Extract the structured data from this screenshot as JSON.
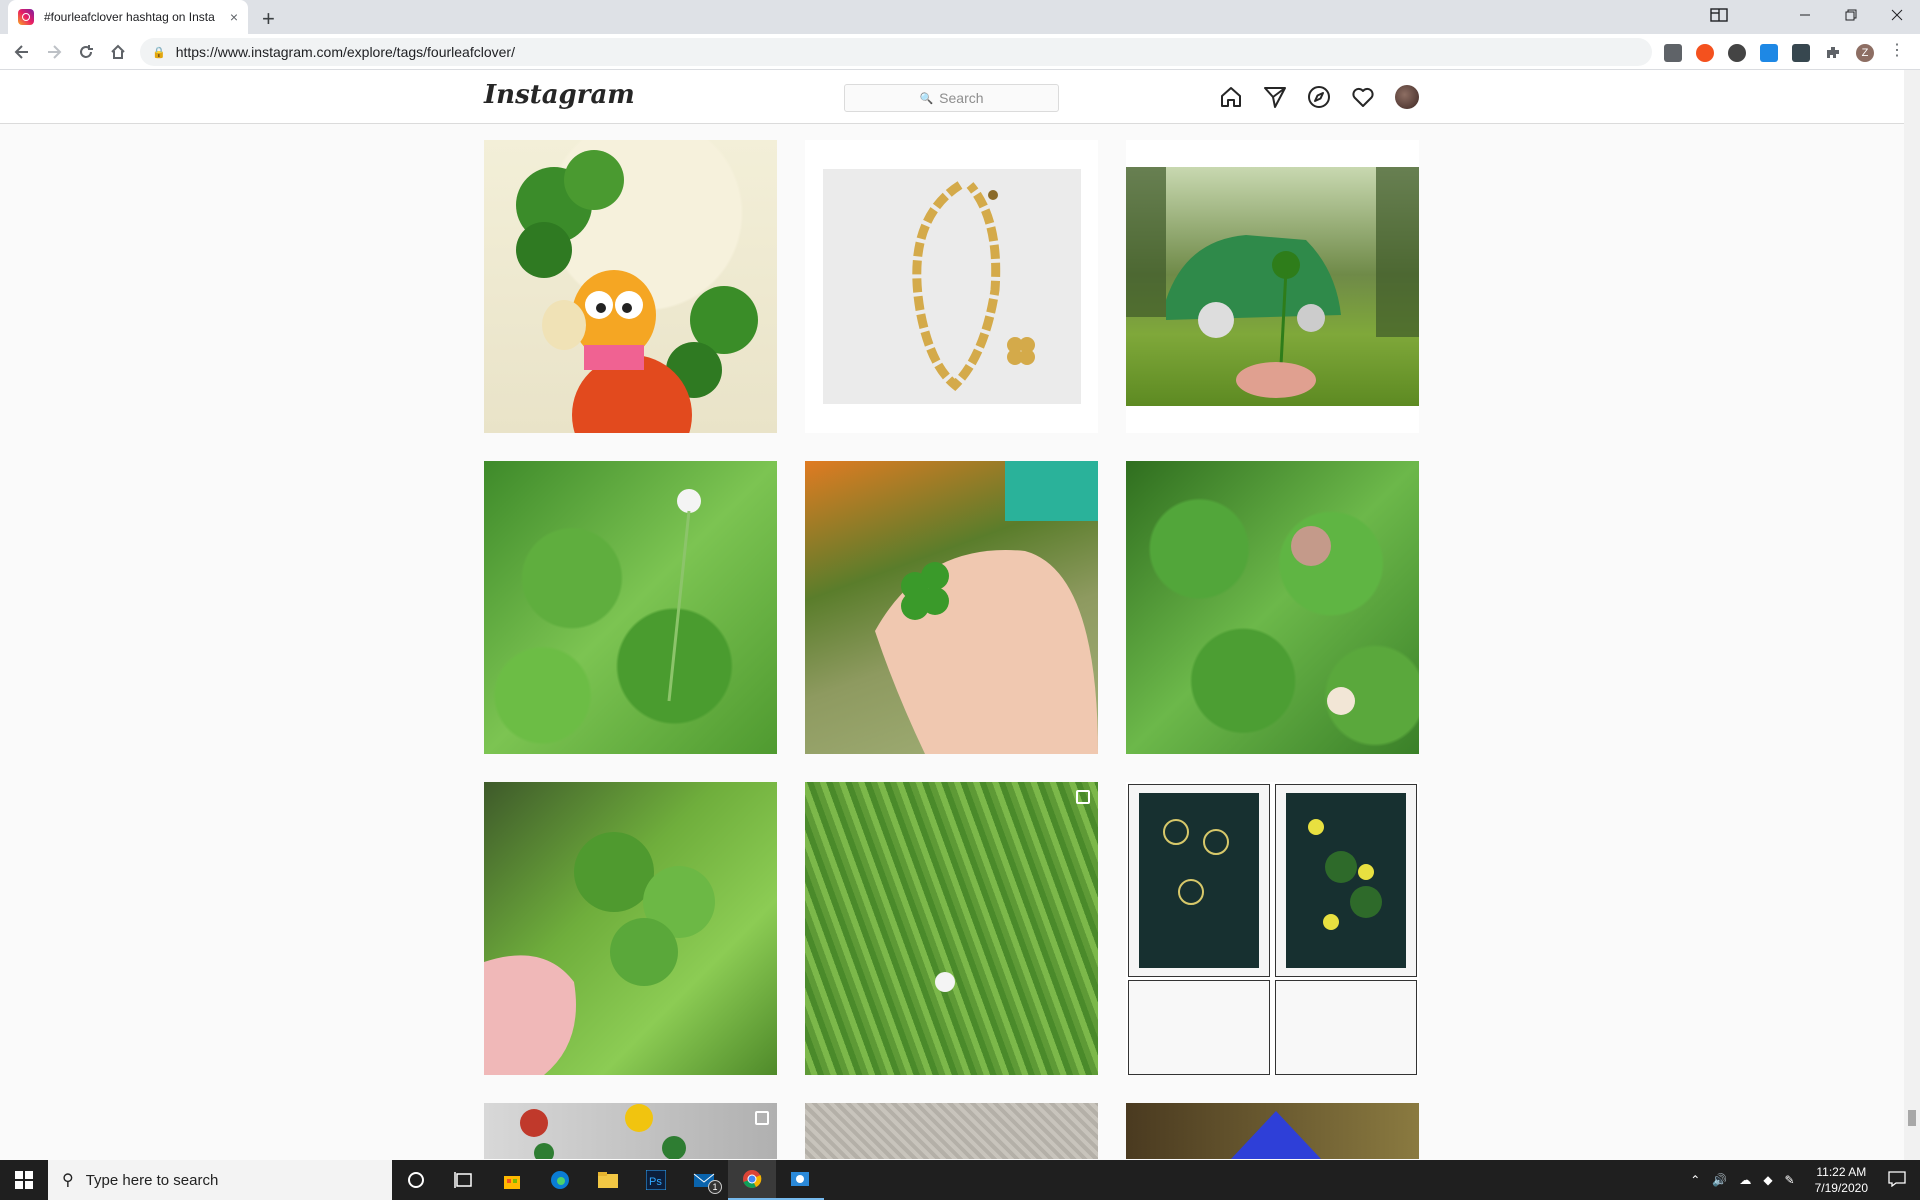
{
  "browser": {
    "tab_title": "#fourleafclover hashtag on Insta",
    "new_tab": "+",
    "close": "×",
    "url": "https://www.instagram.com/explore/tags/fourleafclover/",
    "profile_initial": "Z"
  },
  "instagram": {
    "logo": "Instagram",
    "search_placeholder": "Search",
    "nav_icons": [
      "home-icon",
      "direct-icon",
      "explore-icon",
      "activity-icon",
      "profile-avatar"
    ]
  },
  "grid": {
    "posts": [
      {
        "name": "garfield-clover",
        "multi": false
      },
      {
        "name": "gold-clover-bracelet",
        "multi": false
      },
      {
        "name": "green-car-clover",
        "multi": false
      },
      {
        "name": "clover-field",
        "multi": false
      },
      {
        "name": "hand-holding-clover",
        "multi": false
      },
      {
        "name": "clover-closeup",
        "multi": false
      },
      {
        "name": "hand-clover-leaves",
        "multi": false
      },
      {
        "name": "grass-clover",
        "multi": true
      },
      {
        "name": "clover-prints",
        "multi": false
      },
      {
        "name": "roses-clover",
        "multi": true
      },
      {
        "name": "knitted-item",
        "multi": false
      },
      {
        "name": "dark-blue-item",
        "multi": false
      }
    ]
  },
  "taskbar": {
    "search_placeholder": "Type here to search",
    "time": "11:22 AM",
    "date": "7/19/2020",
    "mail_badge": "1"
  }
}
